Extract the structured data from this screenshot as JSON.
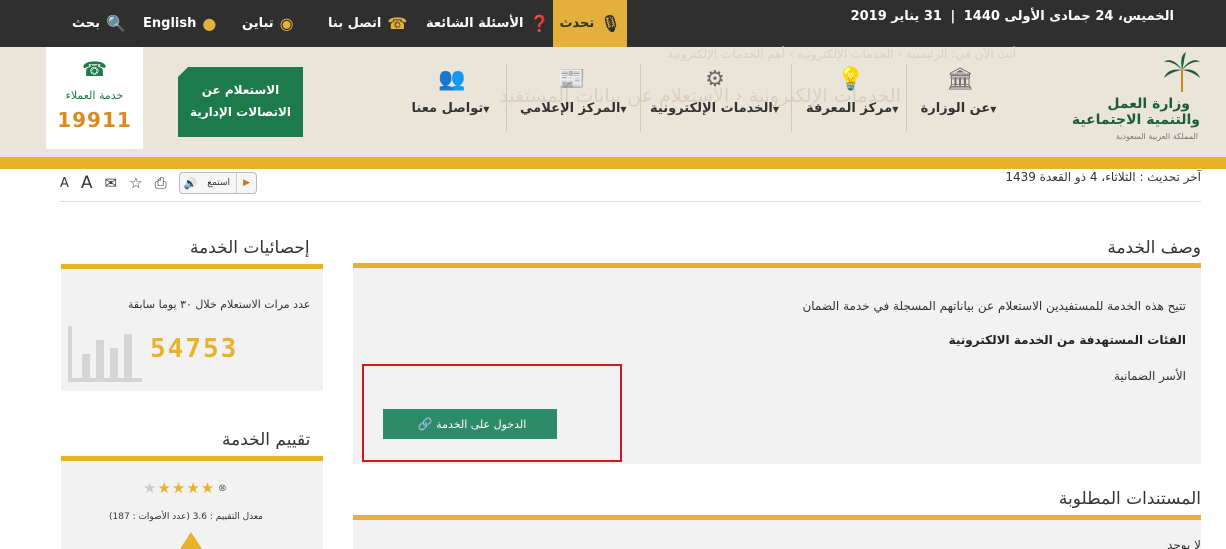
{
  "topbar": {
    "date": "الخميس، 24 جمادى الأولى 1440",
    "date_sep": "|",
    "gregorian": "31 يناير 2019",
    "speak": "تحدث",
    "faq": "الأسئلة الشائعة",
    "contact": "اتصل بنا",
    "contrast": "تباين",
    "english": "English",
    "search": "بحث"
  },
  "header": {
    "ghost_text": "الخدمات الإلكترونية ‹ الاستعلام عن بيانات المستفيد",
    "ghost_text2": "أنت الآن في: الرئيسية › الخدمات الإلكترونية › أهم الخدمات الإلكترونية",
    "logo_line1": "وزارة العمل",
    "logo_line2": "والتنمية الاجتماعية",
    "logo_line3": "المملكة العربية السعودية",
    "nav": [
      {
        "label": "عن الوزارة",
        "icon": "building-icon"
      },
      {
        "label": "مركز المعرفة",
        "icon": "lightbulb-icon"
      },
      {
        "label": "الخدمات الإلكترونية",
        "icon": "gears-icon"
      },
      {
        "label": "المركز الإعلامي",
        "icon": "newspaper-icon"
      },
      {
        "label": "تواصل معنا",
        "icon": "people-icon"
      }
    ],
    "inquiry_line1": "الاستعلام عن",
    "inquiry_line2": "الاتصالات الإدارية",
    "customer_label": "خدمة العملاء",
    "customer_number": "19911"
  },
  "toolbar": {
    "listen": "استمع",
    "last_update": "آخر تحديث : الثلاثاء، 4 ذو القعدة 1439"
  },
  "main": {
    "service_desc_title": "وصف الخدمة",
    "service_desc": "تتيح هذه الخدمة للمستفيدين الاستعلام عن بياناتهم المسجلة في خدمة الضمان",
    "targets_title": "الفئات المستهدفة من الخدمة الالكترونية",
    "targets_value": "الأسر الضمانية",
    "enter_button": "الدخول على الخدمة",
    "docs_title": "المستندات المطلوبة",
    "docs_body": "لا يوجد"
  },
  "sidebar": {
    "stats_title": "إحصائيات الخدمة",
    "stats_label": "عدد مرات الاستعلام خلال ٣٠ يوما سابقة",
    "stats_value": "54753",
    "rating_title": "تقييم الخدمة",
    "rating_stars": 5,
    "rating_text": "معدل التقييم : 3.6 (عدد الأصوات : 187)"
  },
  "colors": {
    "accent_gold": "#e9b22a",
    "brand_green": "#1d7a4a",
    "highlight_red": "#d8141b"
  }
}
